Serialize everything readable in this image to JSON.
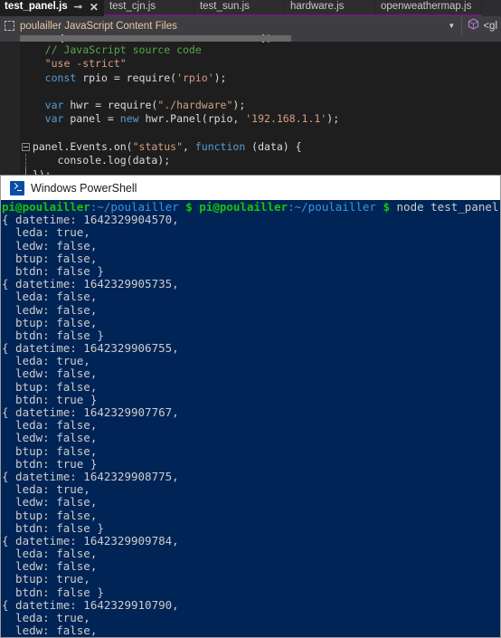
{
  "editor": {
    "tabs": [
      {
        "label": "test_panel.js",
        "active": true,
        "pin_icon": "pin-icon",
        "close_icon": "close-icon"
      },
      {
        "label": "test_cjn.js",
        "active": false
      },
      {
        "label": "test_sun.js",
        "active": false
      },
      {
        "label": "hardware.js",
        "active": false
      },
      {
        "label": "openweathermap.js",
        "active": false
      }
    ],
    "nav_bar": {
      "project_icon": "project-folder-icon",
      "project_label": "poulailler JavaScript Content Files",
      "caret_icon": "chevron-down-icon",
      "scope_icon": "cube-icon",
      "scope_label": "<gl"
    },
    "code_lines": [
      {
        "indent": 4,
        "tokens": [
          {
            "t": "// JavaScript source code",
            "c": "comment"
          }
        ]
      },
      {
        "indent": 4,
        "tokens": [
          {
            "t": "\"use -strict\"",
            "c": "string"
          }
        ]
      },
      {
        "indent": 4,
        "tokens": [
          {
            "t": "const",
            "c": "keyword"
          },
          {
            "t": " rpio = require(",
            "c": "plain"
          },
          {
            "t": "'rpio'",
            "c": "string"
          },
          {
            "t": ");",
            "c": "plain"
          }
        ]
      },
      {
        "indent": 0,
        "tokens": []
      },
      {
        "indent": 4,
        "tokens": [
          {
            "t": "var",
            "c": "keyword"
          },
          {
            "t": " hwr = require(",
            "c": "plain"
          },
          {
            "t": "\"./hardware\"",
            "c": "string"
          },
          {
            "t": ");",
            "c": "plain"
          }
        ]
      },
      {
        "indent": 4,
        "tokens": [
          {
            "t": "var",
            "c": "keyword"
          },
          {
            "t": " panel = ",
            "c": "plain"
          },
          {
            "t": "new",
            "c": "keyword"
          },
          {
            "t": " hwr.Panel(rpio, ",
            "c": "plain"
          },
          {
            "t": "'192.168.1.1'",
            "c": "string"
          },
          {
            "t": ");",
            "c": "plain"
          }
        ]
      },
      {
        "indent": 0,
        "tokens": []
      },
      {
        "indent": 2,
        "fold": "box",
        "tokens": [
          {
            "t": "panel.Events.on(",
            "c": "plain"
          },
          {
            "t": "\"status\"",
            "c": "string"
          },
          {
            "t": ", ",
            "c": "plain"
          },
          {
            "t": "function",
            "c": "keyword"
          },
          {
            "t": " (data) {",
            "c": "plain"
          }
        ]
      },
      {
        "indent": 2,
        "fold": "dash",
        "tokens": [
          {
            "t": "    console.log(data);",
            "c": "plain"
          }
        ]
      },
      {
        "indent": 2,
        "fold": "solid",
        "tokens": [
          {
            "t": "});",
            "c": "plain"
          }
        ]
      }
    ]
  },
  "powershell": {
    "title": "Windows PowerShell",
    "icon": "powershell-icon",
    "prompt": {
      "user": "pi@poulailler",
      "path": ":~/poulailler",
      "dollar": "$",
      "command": "node test_panel.js"
    },
    "output_blocks": [
      {
        "datetime": "1642329904570",
        "leda": "true",
        "ledw": "false",
        "btup": "false",
        "btdn": "false"
      },
      {
        "datetime": "1642329905735",
        "leda": "false",
        "ledw": "false",
        "btup": "false",
        "btdn": "false"
      },
      {
        "datetime": "1642329906755",
        "leda": "true",
        "ledw": "false",
        "btup": "false",
        "btdn": "true"
      },
      {
        "datetime": "1642329907767",
        "leda": "false",
        "ledw": "false",
        "btup": "false",
        "btdn": "true"
      },
      {
        "datetime": "1642329908775",
        "leda": "true",
        "ledw": "false",
        "btup": "false",
        "btdn": "false"
      },
      {
        "datetime": "1642329909784",
        "leda": "false",
        "ledw": "false",
        "btup": "true",
        "btdn": "false"
      },
      {
        "datetime": "1642329910790",
        "leda": "true",
        "ledw": "false",
        "btup": "",
        "btdn": ""
      }
    ],
    "field_names": {
      "datetime": "datetime",
      "leda": "leda",
      "ledw": "ledw",
      "btup": "btup",
      "btdn": "btdn"
    }
  },
  "colors": {
    "tab_accent": "#68217a",
    "console_bg": "#012456",
    "prompt_user": "#16c60c",
    "prompt_path": "#3a96dd",
    "comment": "#57a64a",
    "keyword": "#569cd6",
    "string": "#d69d85"
  }
}
